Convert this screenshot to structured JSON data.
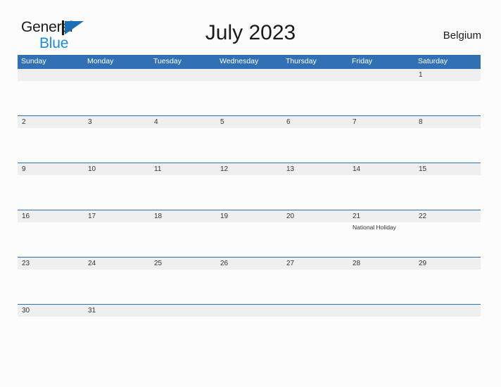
{
  "brand": {
    "word_general": "General",
    "word_blue": "Blue",
    "mark": "triangle-logo"
  },
  "header": {
    "title": "July 2023",
    "locale": "Belgium"
  },
  "colors": {
    "header_blue": "#3070b3",
    "row_divider_blue": "#3070b3",
    "day_band_gray": "#efefef",
    "brand_blue": "#1b8cd8",
    "page_background": "#fcfcfc",
    "text_dark": "#1a1a1a"
  },
  "calendar": {
    "weekday_headers": [
      "Sunday",
      "Monday",
      "Tuesday",
      "Wednesday",
      "Thursday",
      "Friday",
      "Saturday"
    ],
    "weeks": [
      [
        {
          "date": "",
          "event": ""
        },
        {
          "date": "",
          "event": ""
        },
        {
          "date": "",
          "event": ""
        },
        {
          "date": "",
          "event": ""
        },
        {
          "date": "",
          "event": ""
        },
        {
          "date": "",
          "event": ""
        },
        {
          "date": "1",
          "event": ""
        }
      ],
      [
        {
          "date": "2",
          "event": ""
        },
        {
          "date": "3",
          "event": ""
        },
        {
          "date": "4",
          "event": ""
        },
        {
          "date": "5",
          "event": ""
        },
        {
          "date": "6",
          "event": ""
        },
        {
          "date": "7",
          "event": ""
        },
        {
          "date": "8",
          "event": ""
        }
      ],
      [
        {
          "date": "9",
          "event": ""
        },
        {
          "date": "10",
          "event": ""
        },
        {
          "date": "11",
          "event": ""
        },
        {
          "date": "12",
          "event": ""
        },
        {
          "date": "13",
          "event": ""
        },
        {
          "date": "14",
          "event": ""
        },
        {
          "date": "15",
          "event": ""
        }
      ],
      [
        {
          "date": "16",
          "event": ""
        },
        {
          "date": "17",
          "event": ""
        },
        {
          "date": "18",
          "event": ""
        },
        {
          "date": "19",
          "event": ""
        },
        {
          "date": "20",
          "event": ""
        },
        {
          "date": "21",
          "event": "National Holiday"
        },
        {
          "date": "22",
          "event": ""
        }
      ],
      [
        {
          "date": "23",
          "event": ""
        },
        {
          "date": "24",
          "event": ""
        },
        {
          "date": "25",
          "event": ""
        },
        {
          "date": "26",
          "event": ""
        },
        {
          "date": "27",
          "event": ""
        },
        {
          "date": "28",
          "event": ""
        },
        {
          "date": "29",
          "event": ""
        }
      ],
      [
        {
          "date": "30",
          "event": ""
        },
        {
          "date": "31",
          "event": ""
        },
        {
          "date": "",
          "event": ""
        },
        {
          "date": "",
          "event": ""
        },
        {
          "date": "",
          "event": ""
        },
        {
          "date": "",
          "event": ""
        },
        {
          "date": "",
          "event": ""
        }
      ]
    ]
  }
}
